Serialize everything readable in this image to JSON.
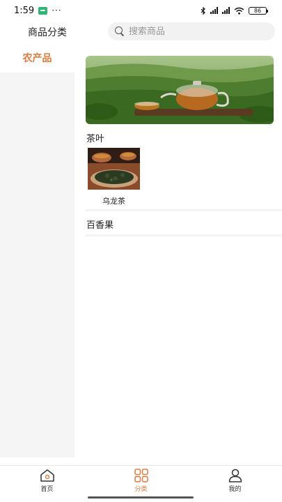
{
  "status_bar": {
    "time": "1:59",
    "dots": "···",
    "battery": "86"
  },
  "header": {
    "title": "商品分类",
    "search_placeholder": "搜索商品"
  },
  "sidebar": {
    "items": [
      {
        "label": "农产品",
        "active": true
      }
    ]
  },
  "main": {
    "sections": [
      {
        "title": "茶叶",
        "products": [
          {
            "label": "乌龙茶"
          }
        ]
      },
      {
        "title": "百香果",
        "products": []
      }
    ]
  },
  "tabbar": {
    "tabs": [
      {
        "label": "首页",
        "icon": "home-icon"
      },
      {
        "label": "分类",
        "icon": "category-grid-icon",
        "active": true
      },
      {
        "label": "我的",
        "icon": "user-icon"
      }
    ]
  },
  "colors": {
    "accent": "#e07a3c",
    "sidebar_bg": "#f5f5f5"
  }
}
